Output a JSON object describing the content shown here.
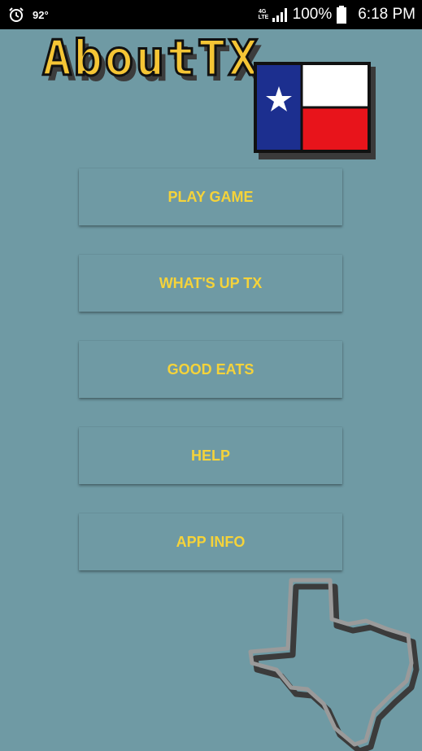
{
  "status_bar": {
    "temperature": "92°",
    "network": "4G LTE",
    "battery": "100%",
    "time": "6:18 PM",
    "icons": [
      "alarm-icon",
      "signal-icon",
      "battery-icon"
    ]
  },
  "logo": {
    "text": "AboutTX",
    "colors": {
      "text": "#f5c535",
      "flag_blue": "#1c2f8f",
      "flag_red": "#e8141b",
      "flag_white": "#ffffff"
    }
  },
  "menu": {
    "items": [
      {
        "label": "PLAY GAME"
      },
      {
        "label": "WHAT'S UP TX"
      },
      {
        "label": "GOOD EATS"
      },
      {
        "label": "HELP"
      },
      {
        "label": "APP INFO"
      }
    ]
  },
  "colors": {
    "background": "#6f9aa4",
    "button_text": "#f5d33a"
  }
}
